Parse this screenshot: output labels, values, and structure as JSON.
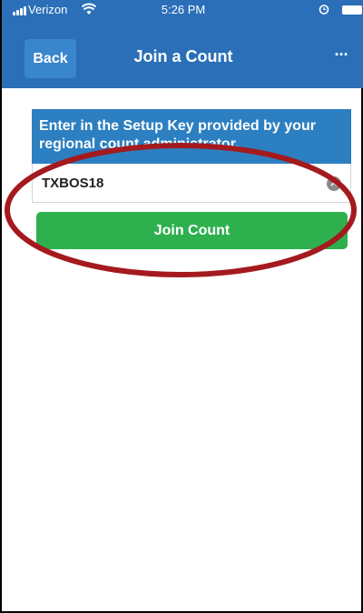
{
  "status_bar": {
    "carrier": "Verizon",
    "time": "5:26 PM"
  },
  "nav": {
    "back_label": "Back",
    "title": "Join a Count",
    "more_label": "···"
  },
  "form": {
    "prompt": "Enter in the Setup Key provided by your regional count administrator.",
    "setup_key_value": "TXBOS18",
    "join_label": "Join Count"
  },
  "colors": {
    "header_blue": "#2a6fb8",
    "prompt_blue": "#2c7fc1",
    "join_green": "#2fb04f",
    "annotation_red": "#a41a1e"
  },
  "icons": {
    "signal": "signal-bars-icon",
    "wifi": "wifi-icon",
    "alarm": "alarm-icon",
    "battery": "battery-icon",
    "clear": "clear-icon"
  }
}
